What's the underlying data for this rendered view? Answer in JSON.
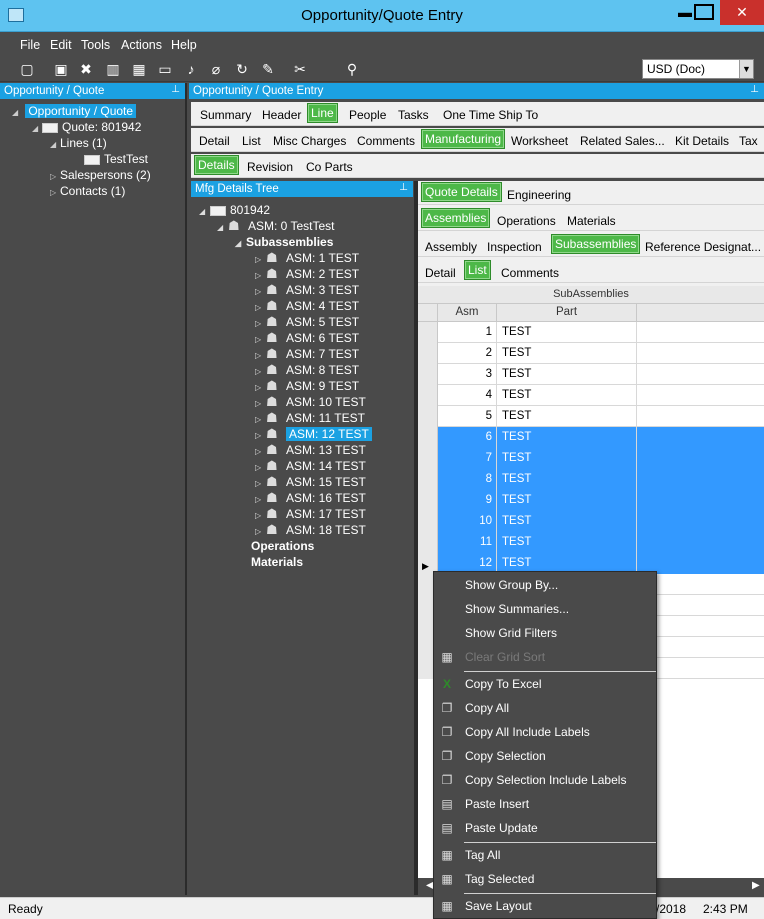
{
  "window": {
    "title": "Opportunity/Quote Entry",
    "minimize": "▬",
    "maximize": "□",
    "close": "✕"
  },
  "menu": [
    "File",
    "Edit",
    "Tools",
    "Actions",
    "Help"
  ],
  "toolbar": {
    "currency": "USD (Doc)"
  },
  "left_panel": {
    "title": "Opportunity / Quote",
    "tree": {
      "root": "Opportunity / Quote",
      "quote": "Quote: 801942",
      "lines": "Lines (1)",
      "line_item": "TestTest",
      "salespersons": "Salespersons (2)",
      "contacts": "Contacts (1)"
    }
  },
  "main_panel": {
    "title": "Opportunity / Quote Entry",
    "tabs_row1": [
      "Summary",
      "Header",
      "Line",
      "People",
      "Tasks",
      "One Time Ship To"
    ],
    "tabs_row2": [
      "Detail",
      "List",
      "Misc Charges",
      "Comments",
      "Manufacturing",
      "Worksheet",
      "Related Sales...",
      "Kit Details",
      "Tax"
    ],
    "tabs_row3": [
      "Details",
      "Revision",
      "Co Parts"
    ]
  },
  "mfg_tree": {
    "title": "Mfg Details Tree",
    "root": "801942",
    "asm0": "ASM: 0 TestTest",
    "subassemblies": "Subassemblies",
    "items": [
      "ASM: 1 TEST",
      "ASM: 2 TEST",
      "ASM: 3 TEST",
      "ASM: 4 TEST",
      "ASM: 5 TEST",
      "ASM: 6 TEST",
      "ASM: 7 TEST",
      "ASM: 8 TEST",
      "ASM: 9 TEST",
      "ASM: 10 TEST",
      "ASM: 11 TEST",
      "ASM: 12 TEST",
      "ASM: 13 TEST",
      "ASM: 14 TEST",
      "ASM: 15 TEST",
      "ASM: 16 TEST",
      "ASM: 17 TEST",
      "ASM: 18 TEST"
    ],
    "selected_index": 11,
    "operations": "Operations",
    "materials": "Materials"
  },
  "right_tabs": {
    "row1": [
      "Quote Details",
      "Engineering"
    ],
    "row2": [
      "Assemblies",
      "Operations",
      "Materials"
    ],
    "row3": [
      "Assembly",
      "Inspection",
      "Subassemblies",
      "Reference Designat..."
    ],
    "row4": [
      "Detail",
      "List",
      "Comments"
    ]
  },
  "grid": {
    "group_header": "SubAssemblies",
    "columns": [
      "Asm",
      "Part"
    ],
    "rows": [
      {
        "asm": "1",
        "part": "TEST",
        "selected": false
      },
      {
        "asm": "2",
        "part": "TEST",
        "selected": false
      },
      {
        "asm": "3",
        "part": "TEST",
        "selected": false
      },
      {
        "asm": "4",
        "part": "TEST",
        "selected": false
      },
      {
        "asm": "5",
        "part": "TEST",
        "selected": false
      },
      {
        "asm": "6",
        "part": "TEST",
        "selected": true
      },
      {
        "asm": "7",
        "part": "TEST",
        "selected": true
      },
      {
        "asm": "8",
        "part": "TEST",
        "selected": true
      },
      {
        "asm": "9",
        "part": "TEST",
        "selected": true
      },
      {
        "asm": "10",
        "part": "TEST",
        "selected": true
      },
      {
        "asm": "11",
        "part": "TEST",
        "selected": true
      },
      {
        "asm": "12",
        "part": "TEST",
        "selected": true
      }
    ]
  },
  "context_menu": [
    {
      "label": "Show Group By...",
      "icon": ""
    },
    {
      "label": "Show Summaries...",
      "icon": ""
    },
    {
      "label": "Show Grid Filters",
      "icon": ""
    },
    {
      "label": "Clear Grid Sort",
      "icon": "grid-icon",
      "disabled": true
    },
    {
      "label": "Copy To Excel",
      "icon": "excel-icon"
    },
    {
      "label": "Copy All",
      "icon": "copy-icon"
    },
    {
      "label": "Copy All Include Labels",
      "icon": "copy-icon"
    },
    {
      "label": "Copy Selection",
      "icon": "copy-icon"
    },
    {
      "label": "Copy Selection Include Labels",
      "icon": "copy-icon"
    },
    {
      "label": "Paste Insert",
      "icon": "paste-icon"
    },
    {
      "label": "Paste Update",
      "icon": "paste-icon"
    },
    {
      "label": "Tag All",
      "icon": "grid-icon"
    },
    {
      "label": "Tag Selected",
      "icon": "grid-icon"
    },
    {
      "label": "Save Layout",
      "icon": "grid-icon"
    }
  ],
  "status": {
    "text": "Ready",
    "date": "/2018",
    "time": "2:43 PM"
  }
}
